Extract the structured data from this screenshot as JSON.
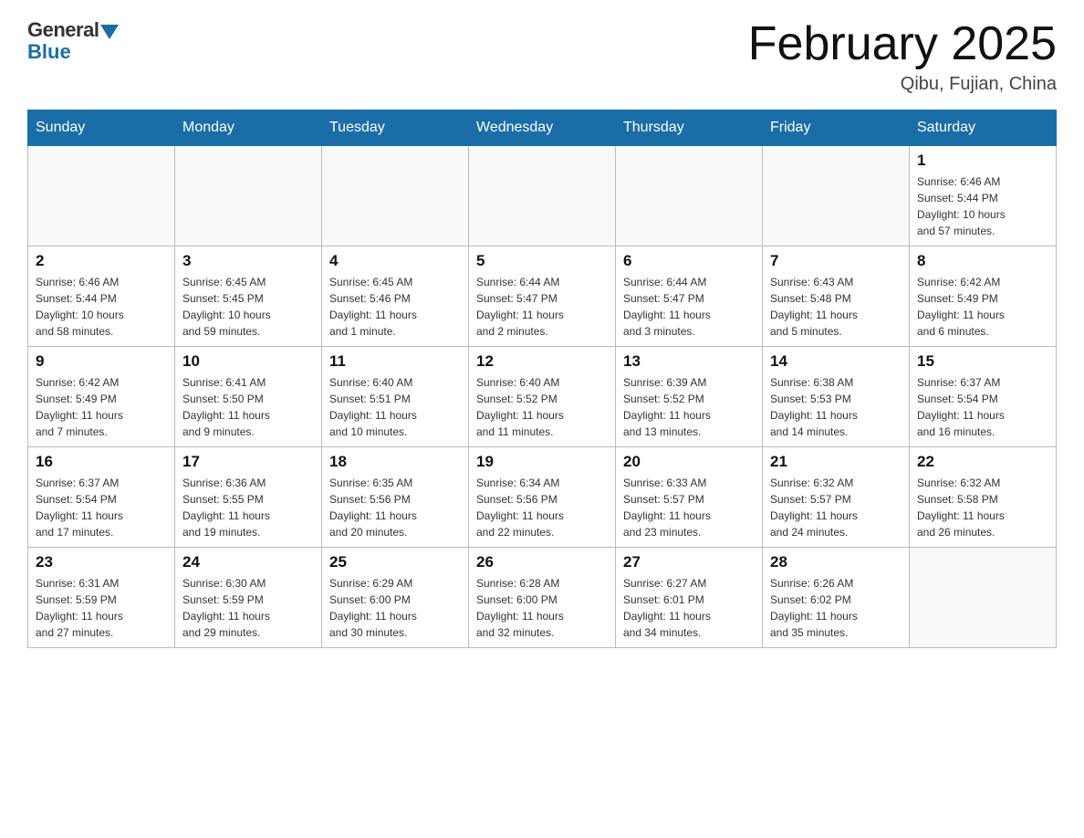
{
  "header": {
    "logo_general": "General",
    "logo_blue": "Blue",
    "month_title": "February 2025",
    "location": "Qibu, Fujian, China"
  },
  "days_of_week": [
    "Sunday",
    "Monday",
    "Tuesday",
    "Wednesday",
    "Thursday",
    "Friday",
    "Saturday"
  ],
  "weeks": [
    [
      {
        "date": "",
        "info": ""
      },
      {
        "date": "",
        "info": ""
      },
      {
        "date": "",
        "info": ""
      },
      {
        "date": "",
        "info": ""
      },
      {
        "date": "",
        "info": ""
      },
      {
        "date": "",
        "info": ""
      },
      {
        "date": "1",
        "info": "Sunrise: 6:46 AM\nSunset: 5:44 PM\nDaylight: 10 hours\nand 57 minutes."
      }
    ],
    [
      {
        "date": "2",
        "info": "Sunrise: 6:46 AM\nSunset: 5:44 PM\nDaylight: 10 hours\nand 58 minutes."
      },
      {
        "date": "3",
        "info": "Sunrise: 6:45 AM\nSunset: 5:45 PM\nDaylight: 10 hours\nand 59 minutes."
      },
      {
        "date": "4",
        "info": "Sunrise: 6:45 AM\nSunset: 5:46 PM\nDaylight: 11 hours\nand 1 minute."
      },
      {
        "date": "5",
        "info": "Sunrise: 6:44 AM\nSunset: 5:47 PM\nDaylight: 11 hours\nand 2 minutes."
      },
      {
        "date": "6",
        "info": "Sunrise: 6:44 AM\nSunset: 5:47 PM\nDaylight: 11 hours\nand 3 minutes."
      },
      {
        "date": "7",
        "info": "Sunrise: 6:43 AM\nSunset: 5:48 PM\nDaylight: 11 hours\nand 5 minutes."
      },
      {
        "date": "8",
        "info": "Sunrise: 6:42 AM\nSunset: 5:49 PM\nDaylight: 11 hours\nand 6 minutes."
      }
    ],
    [
      {
        "date": "9",
        "info": "Sunrise: 6:42 AM\nSunset: 5:49 PM\nDaylight: 11 hours\nand 7 minutes."
      },
      {
        "date": "10",
        "info": "Sunrise: 6:41 AM\nSunset: 5:50 PM\nDaylight: 11 hours\nand 9 minutes."
      },
      {
        "date": "11",
        "info": "Sunrise: 6:40 AM\nSunset: 5:51 PM\nDaylight: 11 hours\nand 10 minutes."
      },
      {
        "date": "12",
        "info": "Sunrise: 6:40 AM\nSunset: 5:52 PM\nDaylight: 11 hours\nand 11 minutes."
      },
      {
        "date": "13",
        "info": "Sunrise: 6:39 AM\nSunset: 5:52 PM\nDaylight: 11 hours\nand 13 minutes."
      },
      {
        "date": "14",
        "info": "Sunrise: 6:38 AM\nSunset: 5:53 PM\nDaylight: 11 hours\nand 14 minutes."
      },
      {
        "date": "15",
        "info": "Sunrise: 6:37 AM\nSunset: 5:54 PM\nDaylight: 11 hours\nand 16 minutes."
      }
    ],
    [
      {
        "date": "16",
        "info": "Sunrise: 6:37 AM\nSunset: 5:54 PM\nDaylight: 11 hours\nand 17 minutes."
      },
      {
        "date": "17",
        "info": "Sunrise: 6:36 AM\nSunset: 5:55 PM\nDaylight: 11 hours\nand 19 minutes."
      },
      {
        "date": "18",
        "info": "Sunrise: 6:35 AM\nSunset: 5:56 PM\nDaylight: 11 hours\nand 20 minutes."
      },
      {
        "date": "19",
        "info": "Sunrise: 6:34 AM\nSunset: 5:56 PM\nDaylight: 11 hours\nand 22 minutes."
      },
      {
        "date": "20",
        "info": "Sunrise: 6:33 AM\nSunset: 5:57 PM\nDaylight: 11 hours\nand 23 minutes."
      },
      {
        "date": "21",
        "info": "Sunrise: 6:32 AM\nSunset: 5:57 PM\nDaylight: 11 hours\nand 24 minutes."
      },
      {
        "date": "22",
        "info": "Sunrise: 6:32 AM\nSunset: 5:58 PM\nDaylight: 11 hours\nand 26 minutes."
      }
    ],
    [
      {
        "date": "23",
        "info": "Sunrise: 6:31 AM\nSunset: 5:59 PM\nDaylight: 11 hours\nand 27 minutes."
      },
      {
        "date": "24",
        "info": "Sunrise: 6:30 AM\nSunset: 5:59 PM\nDaylight: 11 hours\nand 29 minutes."
      },
      {
        "date": "25",
        "info": "Sunrise: 6:29 AM\nSunset: 6:00 PM\nDaylight: 11 hours\nand 30 minutes."
      },
      {
        "date": "26",
        "info": "Sunrise: 6:28 AM\nSunset: 6:00 PM\nDaylight: 11 hours\nand 32 minutes."
      },
      {
        "date": "27",
        "info": "Sunrise: 6:27 AM\nSunset: 6:01 PM\nDaylight: 11 hours\nand 34 minutes."
      },
      {
        "date": "28",
        "info": "Sunrise: 6:26 AM\nSunset: 6:02 PM\nDaylight: 11 hours\nand 35 minutes."
      },
      {
        "date": "",
        "info": ""
      }
    ]
  ]
}
